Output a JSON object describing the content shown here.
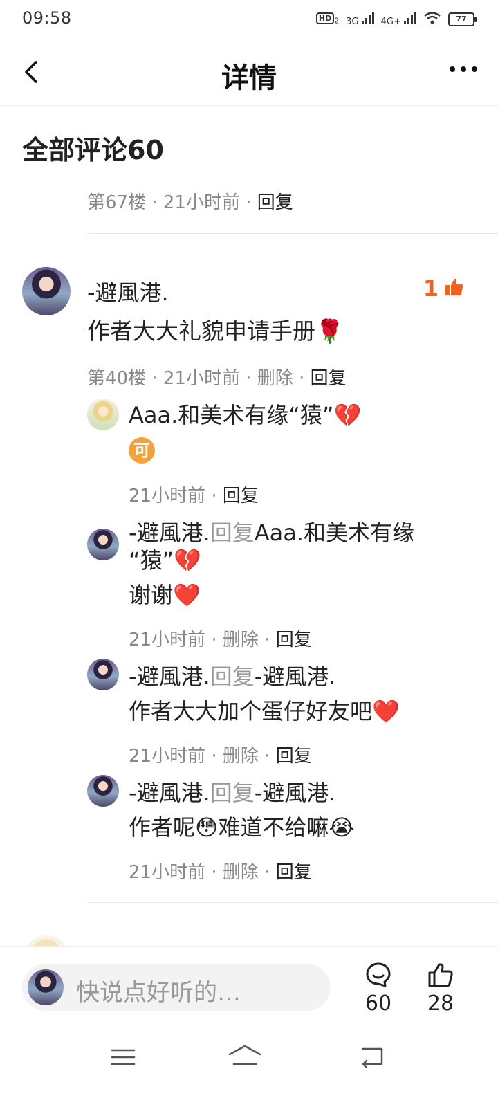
{
  "status_bar": {
    "time": "09:58",
    "hd": "HD",
    "hd_sub": "2",
    "net1": "3G",
    "net2": "4G+",
    "battery": "77"
  },
  "header": {
    "title": "详情",
    "back_icon": "chevron-left-icon",
    "more_icon": "more-horizontal-icon"
  },
  "comments_section": {
    "title": "全部评论60"
  },
  "prev_comment": {
    "floor": "第67楼",
    "time": "21小时前",
    "reply": "回复",
    "sep": "·"
  },
  "comment": {
    "username": "-避風港.",
    "text": "作者大大礼貌申请手册",
    "emoji": "🌹",
    "likes": "1",
    "floor": "第40楼",
    "time": "21小时前",
    "delete": "删除",
    "reply": "回复",
    "sep": "·"
  },
  "replies": [
    {
      "username": "Aaa.和美术有缘“猿”",
      "username_emoji": "💔",
      "text_line2_badge": "可",
      "time": "21小时前",
      "reply": "回复"
    },
    {
      "username": "-避風港.",
      "reply_word": "回复",
      "target_line1": "Aaa.和美术有缘",
      "target_line2": "“猿”",
      "target_emoji": "💔",
      "text": "谢谢",
      "text_emoji": "❤️",
      "time": "21小时前",
      "delete": "删除",
      "reply": "回复"
    },
    {
      "username": "-避風港.",
      "reply_word": "回复",
      "target": "-避風港.",
      "text": "作者大大加个蛋仔好友吧",
      "text_emoji": "❤️",
      "time": "21小时前",
      "delete": "删除",
      "reply": "回复"
    },
    {
      "username": "-避風港.",
      "reply_word": "回复",
      "target": "-避風港.",
      "text_a": "作者呢",
      "emoji_a": "😳",
      "text_b": "难道不给嘛",
      "emoji_b": "😭",
      "time": "21小时前",
      "delete": "删除",
      "reply": "回复"
    }
  ],
  "bottom_bar": {
    "placeholder": "快说点好听的…",
    "comment_count": "60",
    "like_count": "28"
  },
  "colors": {
    "accent": "#f2621c",
    "text": "#222222",
    "muted": "#999999"
  }
}
